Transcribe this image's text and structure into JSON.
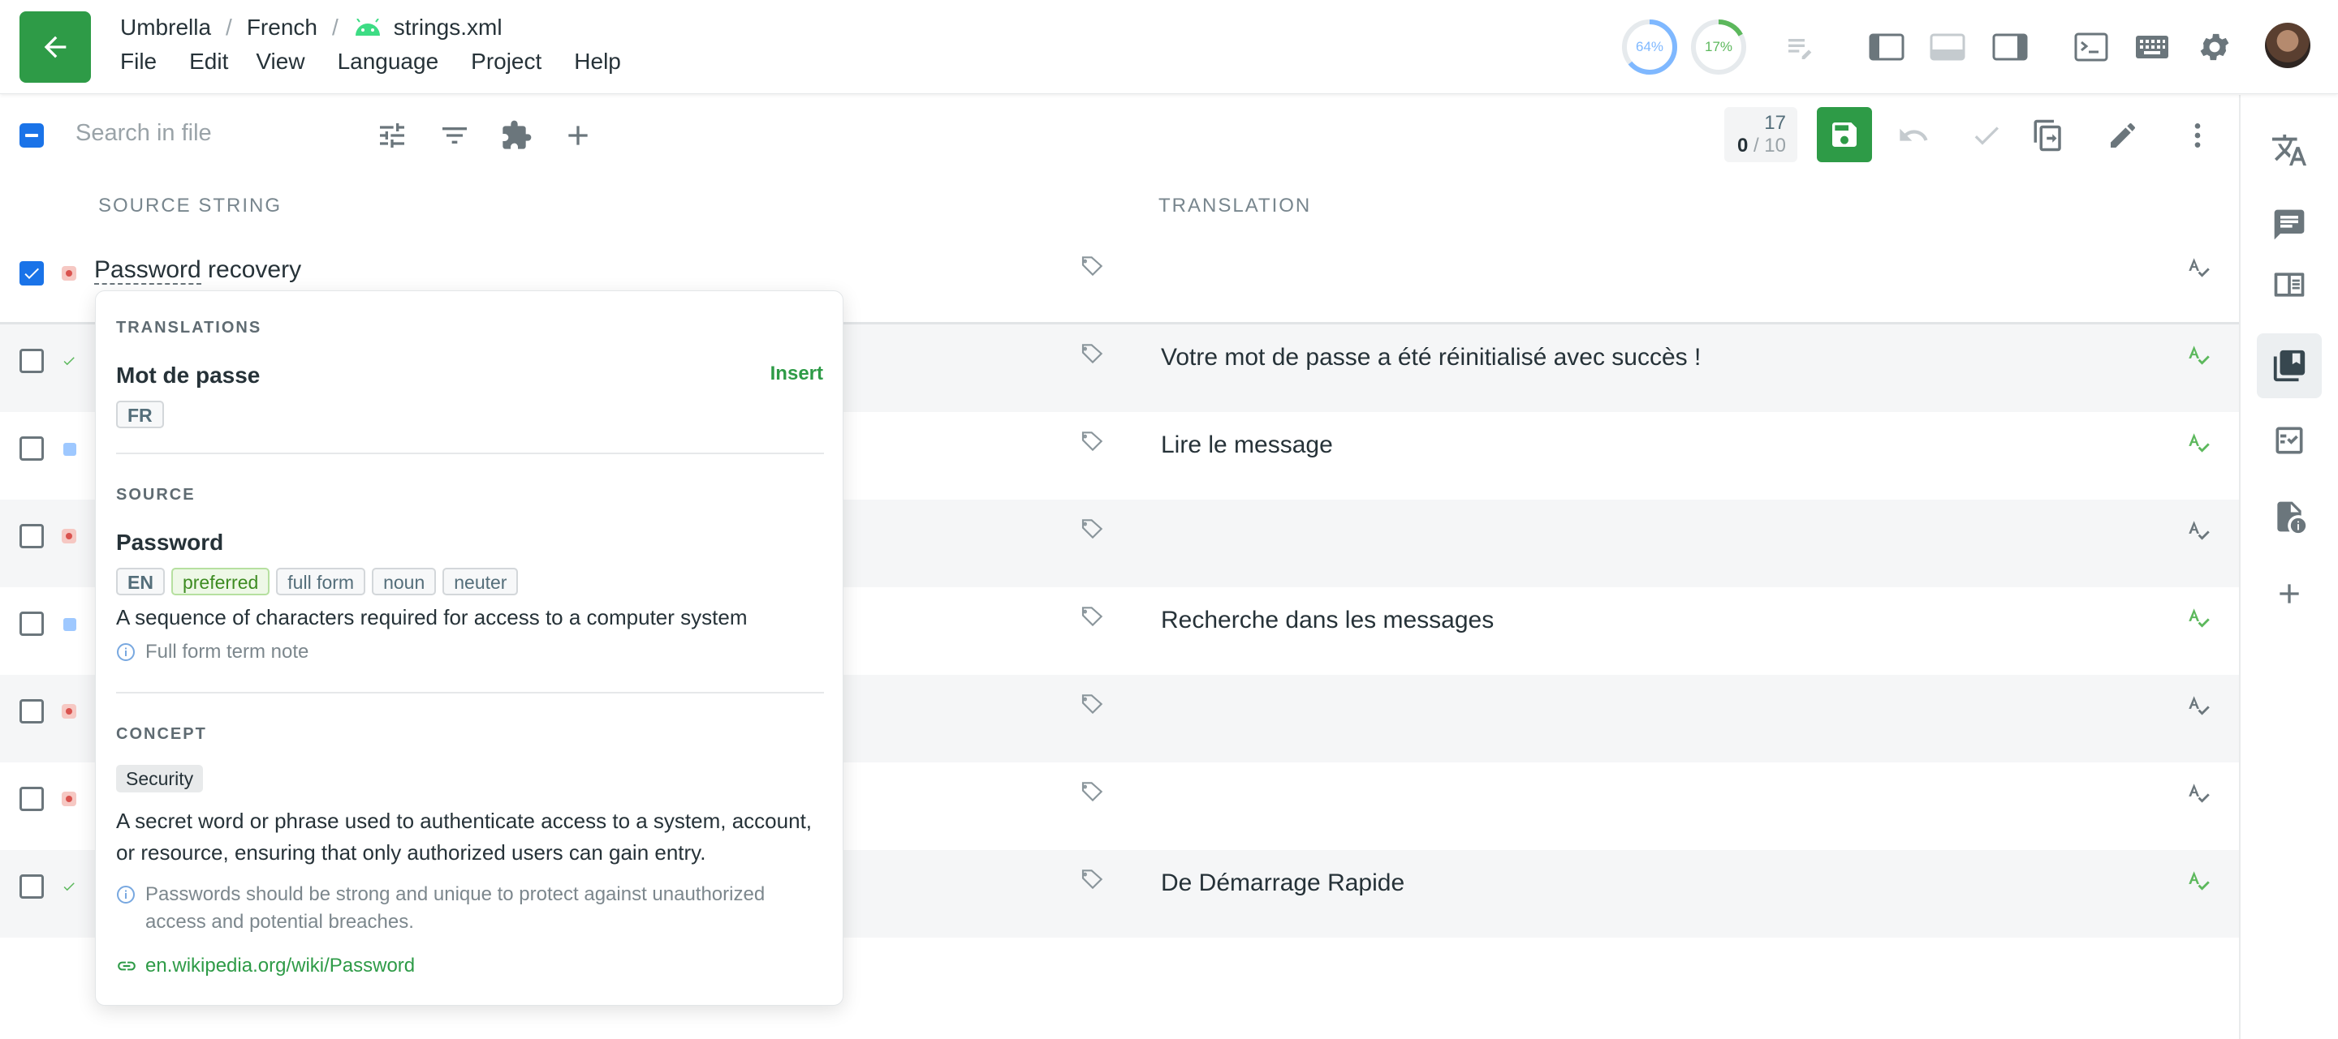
{
  "breadcrumb": {
    "project": "Umbrella",
    "language": "French",
    "file": "strings.xml"
  },
  "menu": [
    "File",
    "Edit",
    "View",
    "Language",
    "Project",
    "Help"
  ],
  "progress": {
    "translated": "64%",
    "translated_value": 64,
    "approved": "17%",
    "approved_value": 17
  },
  "colors": {
    "accent_green": "#2e9b47",
    "checkbox_blue": "#1a73e8",
    "progress_blue": "#7fb8ff",
    "progress_green": "#5cb85c"
  },
  "search": {
    "placeholder": "Search in file"
  },
  "counter": {
    "total": "17",
    "current": "0",
    "of": "/ 10"
  },
  "columns": {
    "source": "SOURCE STRING",
    "translation": "TRANSLATION"
  },
  "rows": [
    {
      "source": "Password recovery",
      "translation": "",
      "status": "untranslated",
      "checked": true
    },
    {
      "source": "",
      "translation": "Votre mot de passe a été réinitialisé avec succès !",
      "status": "approved",
      "checked": false
    },
    {
      "source": "",
      "translation": "Lire le message",
      "status": "translated",
      "checked": false
    },
    {
      "source": "",
      "translation": "",
      "status": "untranslated",
      "checked": false
    },
    {
      "source": "",
      "translation": "Recherche dans les messages",
      "status": "translated",
      "checked": false
    },
    {
      "source": "",
      "translation": "",
      "status": "untranslated",
      "checked": false
    },
    {
      "source": "",
      "translation": "",
      "status": "untranslated",
      "checked": false
    },
    {
      "source": "",
      "translation": "De Démarrage Rapide",
      "status": "approved",
      "checked": false
    }
  ],
  "popup": {
    "translations_label": "TRANSLATIONS",
    "translation_term": "Mot de passe",
    "insert_label": "Insert",
    "translation_lang": "FR",
    "source_label": "SOURCE",
    "source_term": "Password",
    "source_lang": "EN",
    "source_tags": [
      "preferred",
      "full form",
      "noun",
      "neuter"
    ],
    "source_description": "A sequence of characters required for access to a computer system",
    "source_note": "Full form term note",
    "concept_label": "CONCEPT",
    "concept_chip": "Security",
    "concept_definition": "A secret word or phrase used to authenticate access to a system, account, or resource, ensuring that only authorized users can gain entry.",
    "concept_note": "Passwords should be strong and unique to protect against unauthorized access and potential breaches.",
    "concept_link": "en.wikipedia.org/wiki/Password"
  },
  "icons": {
    "header": [
      "arrow-left-icon",
      "android-icon",
      "progress-translated-icon",
      "progress-approved-icon",
      "edit-list-icon",
      "layout-left-panel-icon",
      "layout-bottom-panel-icon",
      "layout-right-panel-icon",
      "terminal-icon",
      "keyboard-icon",
      "gear-icon",
      "avatar"
    ],
    "toolbar": [
      "tune-icon",
      "filter-icon",
      "puzzle-icon",
      "plus-icon",
      "save-icon",
      "undo-icon",
      "check-icon",
      "copy-source-icon",
      "pencil-icon",
      "more-vertical-icon"
    ],
    "sidebar": [
      "translate-icon",
      "comment-icon",
      "tm-icon",
      "glossary-icon",
      "qa-check-icon",
      "file-info-icon",
      "plus-icon"
    ]
  }
}
